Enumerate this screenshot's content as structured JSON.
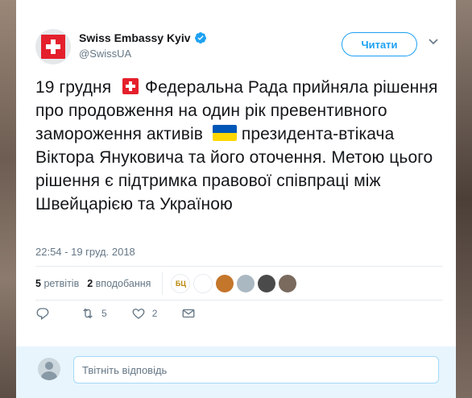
{
  "account": {
    "display_name": "Swiss Embassy Kyiv",
    "handle": "@SwissUA",
    "avatar_icon": "swiss-flag-icon",
    "verified_icon": "verified-badge-icon"
  },
  "follow_button": {
    "label": "Читати"
  },
  "tweet": {
    "line_prefix": "19 грудня",
    "text_part1": "Федеральна Рада прийняла рішення про продовження на один рік превентивного замороження активів",
    "text_part2": "президента-втікача Віктора Януковича та його оточення. Метою цього рішення є підтримка правової співпраці між Швейцарією та Україною",
    "emoji_1": "swiss-flag-emoji",
    "emoji_2": "ukraine-flag-emoji",
    "timestamp": "22:54 - 19 груд. 2018"
  },
  "stats": {
    "retweets_count": "5",
    "retweets_label": "ретвітів",
    "likes_count": "2",
    "likes_label": "вподобання",
    "likers": [
      {
        "initials": "БЦ",
        "color": "#ffffff",
        "fg": "#b8860b"
      },
      {
        "initials": "",
        "color": "#ffffff",
        "fg": "#1f3b8c"
      },
      {
        "initials": "",
        "color": "#c4762b",
        "fg": "#fff"
      },
      {
        "initials": "",
        "color": "#aab8c2",
        "fg": "#fff"
      },
      {
        "initials": "",
        "color": "#4a4a4a",
        "fg": "#fff"
      },
      {
        "initials": "",
        "color": "#7a6a5e",
        "fg": "#fff"
      }
    ]
  },
  "actions": {
    "reply_count": "",
    "retweet_count": "5",
    "like_count": "2",
    "message_count": ""
  },
  "reply": {
    "placeholder": "Твітніть відповідь"
  },
  "colors": {
    "accent": "#1da1f2",
    "muted": "#657786",
    "text": "#14171a",
    "reply_bg": "#e8f5fd"
  }
}
